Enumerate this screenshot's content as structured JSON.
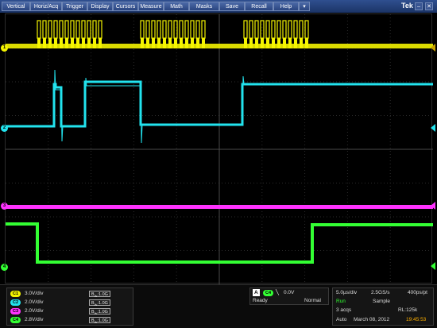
{
  "menu": {
    "items": [
      "Vertical",
      "Horiz/Acq",
      "Trigger",
      "Display",
      "Cursors",
      "Measure",
      "Math",
      "Masks",
      "Save",
      "Recall",
      "Help",
      "▾"
    ]
  },
  "brand": "Tek",
  "window_controls": [
    "–",
    "✕"
  ],
  "channel_markers": [
    {
      "label": "1",
      "color": "#f4f400"
    },
    {
      "label": "2",
      "color": "#22e3ee"
    },
    {
      "label": "3",
      "color": "#ff33ff"
    },
    {
      "label": "4",
      "color": "#33ff33"
    }
  ],
  "channels": [
    {
      "id": "C1",
      "scale": "3.0V/div",
      "bw": "1.0G",
      "color": "#f4f400"
    },
    {
      "id": "C2",
      "scale": "2.0V/div",
      "bw": "1.0G",
      "color": "#22e3ee"
    },
    {
      "id": "C3",
      "scale": "2.0V/div",
      "bw": "1.0G",
      "color": "#ff33ff"
    },
    {
      "id": "C4",
      "scale": "2.8V/div",
      "bw": "1.0G",
      "color": "#33ff33"
    }
  ],
  "trigger": {
    "label": "A",
    "source": "C4",
    "level": "0.0V",
    "state": "Ready",
    "mode": "Normal"
  },
  "acquisition": {
    "timebase": "5.0µs/div",
    "sample_rate": "2.5GS/s",
    "resolution": "400ps/pt",
    "run_state": "Run",
    "mode": "Sample",
    "acqs": "3 acqs",
    "record_length": "RL:125k",
    "trigger_mode": "Auto",
    "date": "March 08, 2012",
    "time": "19:45:53"
  }
}
